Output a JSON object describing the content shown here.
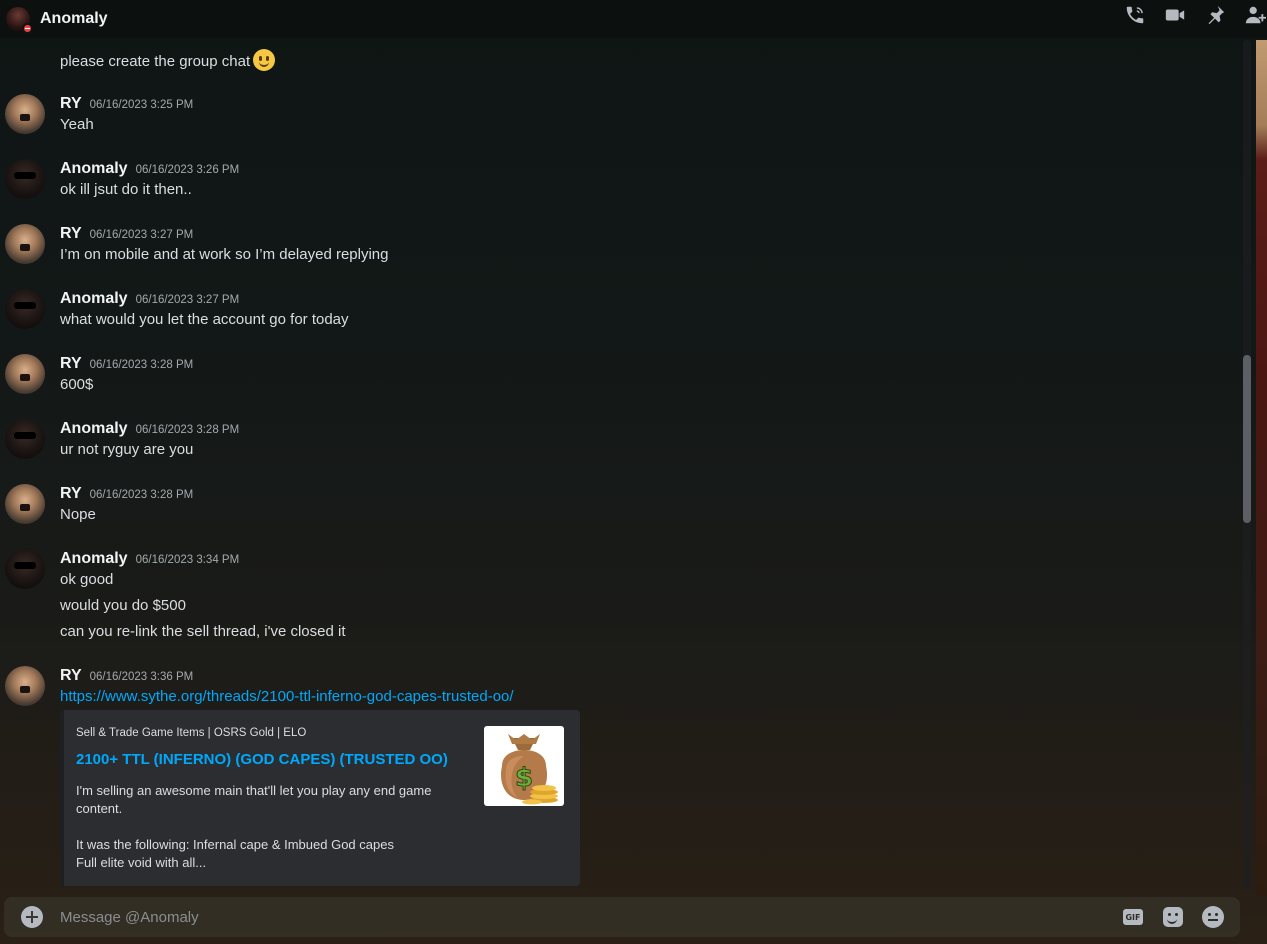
{
  "header": {
    "title": "Anomaly",
    "status": "dnd",
    "icons": [
      "call-icon",
      "video-call-icon",
      "pin-icon",
      "add-friend-icon"
    ]
  },
  "messages": {
    "partial_top": "please create the group chat",
    "groups": [
      {
        "author": "RY",
        "timestamp": "06/16/2023 3:25 PM",
        "lines": [
          "Yeah"
        ]
      },
      {
        "author": "Anomaly",
        "timestamp": "06/16/2023 3:26 PM",
        "lines": [
          "ok ill jsut do it then.."
        ]
      },
      {
        "author": "RY",
        "timestamp": "06/16/2023 3:27 PM",
        "lines": [
          "I’m on mobile and at work so I’m delayed replying"
        ]
      },
      {
        "author": "Anomaly",
        "timestamp": "06/16/2023 3:27 PM",
        "lines": [
          "what would you let the account go for today"
        ]
      },
      {
        "author": "RY",
        "timestamp": "06/16/2023 3:28 PM",
        "lines": [
          "600$"
        ]
      },
      {
        "author": "Anomaly",
        "timestamp": "06/16/2023 3:28 PM",
        "lines": [
          "ur not ryguy are you"
        ]
      },
      {
        "author": "RY",
        "timestamp": "06/16/2023 3:28 PM",
        "lines": [
          "Nope"
        ]
      },
      {
        "author": "Anomaly",
        "timestamp": "06/16/2023 3:34 PM",
        "lines": [
          "ok good",
          "would you do $500",
          "can you re-link the sell thread, i've closed it"
        ]
      },
      {
        "author": "RY",
        "timestamp": "06/16/2023 3:36 PM",
        "lines": [
          "https://www.sythe.org/threads/2100-ttl-inferno-god-capes-trusted-oo/"
        ]
      }
    ]
  },
  "embed": {
    "provider": "Sell & Trade Game Items | OSRS Gold | ELO",
    "title": "2100+ TTL (INFERNO) (GOD CAPES) (TRUSTED OO)",
    "description": "I'm selling an awesome main that'll let you play any end game content.\n\nIt was the following: Infernal cape & Imbued God capes\nFull elite void with all...",
    "thumbnail_icon": "money-bag-icon"
  },
  "composer": {
    "placeholder": "Message @Anomaly",
    "gif_label": "GIF"
  },
  "colors": {
    "link": "#00a8fc",
    "dnd": "#f23f43"
  }
}
